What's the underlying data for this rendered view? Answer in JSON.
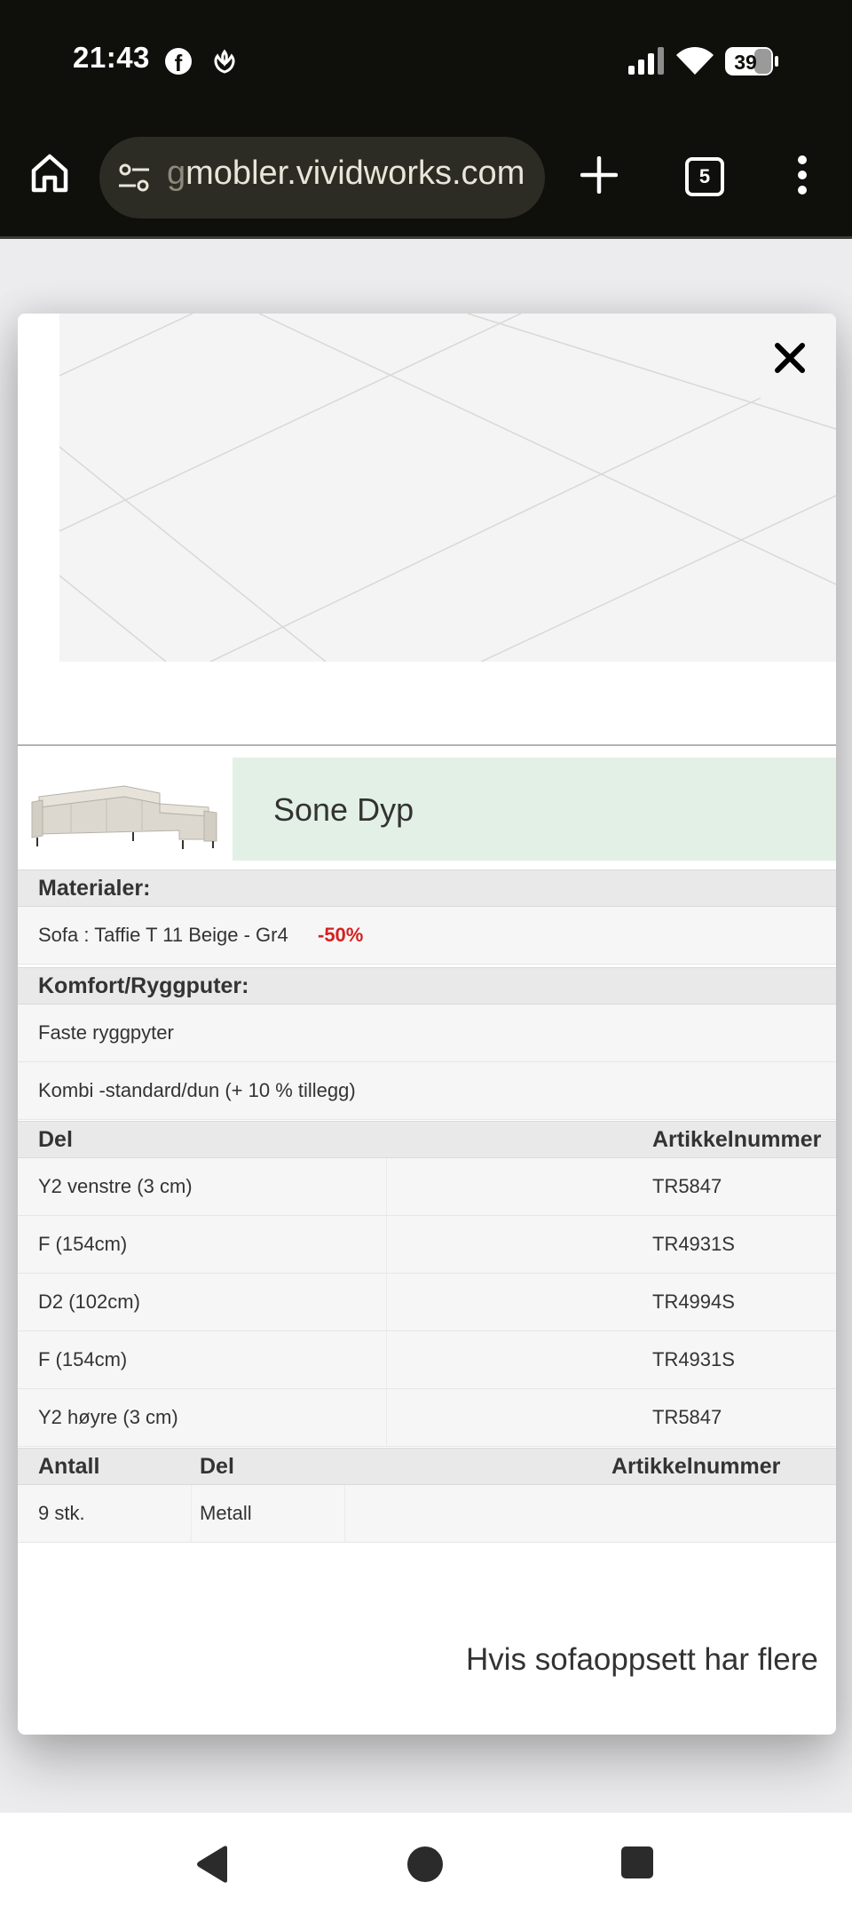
{
  "status_bar": {
    "time": "21:43",
    "battery": "39",
    "icons": [
      "facebook-icon",
      "flower-icon",
      "signal-icon",
      "wifi-icon",
      "battery-icon"
    ]
  },
  "browser": {
    "url_faded": "g",
    "url_main": "mobler.vividworks.com",
    "tab_count": "5",
    "icons": [
      "home-icon",
      "site-settings-icon",
      "new-tab-icon",
      "tab-switcher-icon",
      "menu-icon"
    ]
  },
  "modal": {
    "close_icon": "close-icon",
    "product_name": "Sone Dyp",
    "materials": {
      "header": "Materialer:",
      "item": "Sofa : Taffie T 11 Beige - Gr4",
      "discount": "-50%"
    },
    "comfort": {
      "header": "Komfort/Ryggputer:",
      "items": [
        "Faste ryggpyter",
        "Kombi -standard/dun (+ 10 % tillegg)"
      ]
    },
    "parts": {
      "col_del": "Del",
      "col_art": "Artikkelnummer",
      "rows": [
        {
          "del": "Y2 venstre (3 cm)",
          "art": "TR5847"
        },
        {
          "del": "F (154cm)",
          "art": "TR4931S"
        },
        {
          "del": "D2 (102cm)",
          "art": "TR4994S"
        },
        {
          "del": "F (154cm)",
          "art": "TR4931S"
        },
        {
          "del": "Y2 høyre (3 cm)",
          "art": "TR5847"
        }
      ]
    },
    "legs": {
      "col_antall": "Antall",
      "col_del": "Del",
      "col_art": "Artikkelnummer",
      "rows": [
        {
          "antall": "9 stk.",
          "del": "Metall",
          "art": ""
        }
      ]
    },
    "footnote": "Hvis sofaoppsett har flere"
  },
  "nav_bar": {
    "icons": [
      "back-icon",
      "home-circle-icon",
      "recents-icon"
    ]
  }
}
